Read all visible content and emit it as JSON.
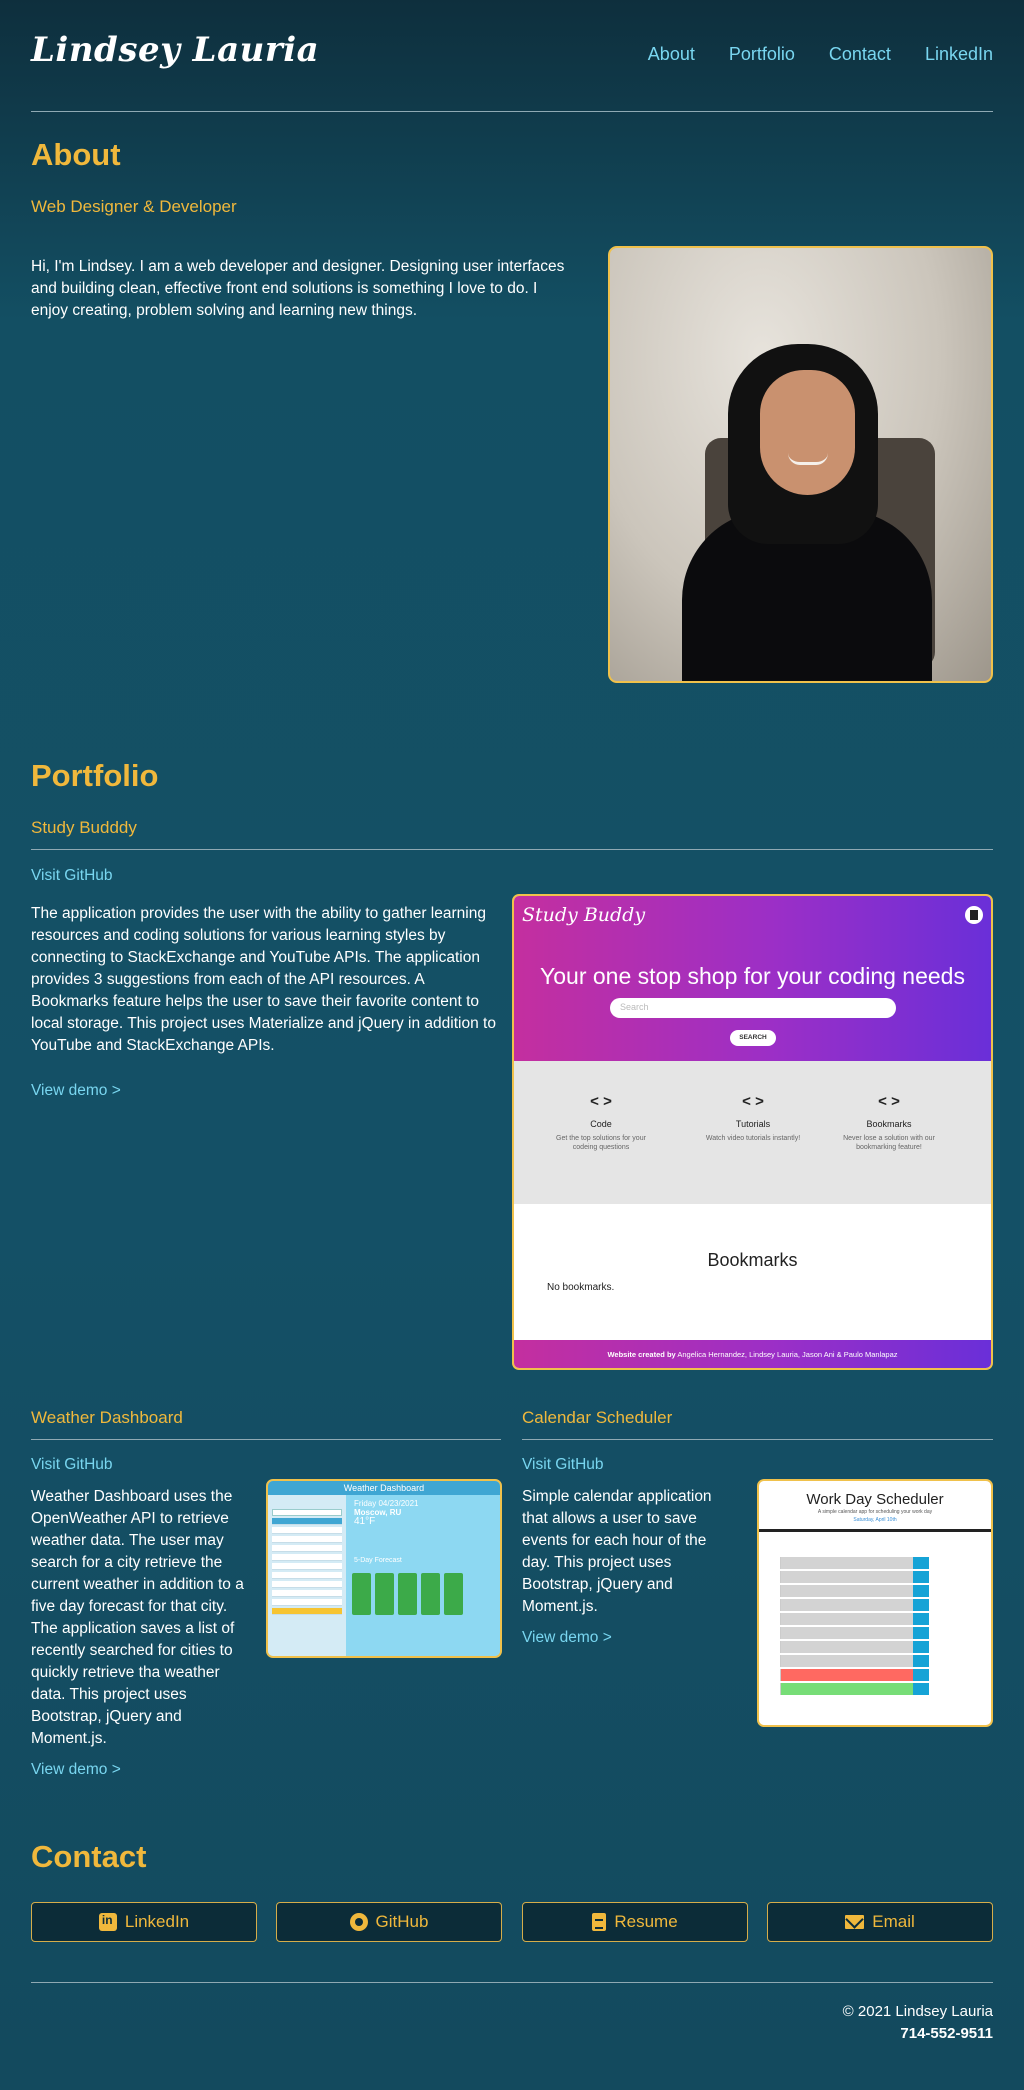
{
  "header": {
    "brand": "Lindsey Lauria",
    "nav": [
      "About",
      "Portfolio",
      "Contact",
      "LinkedIn"
    ]
  },
  "about": {
    "heading": "About",
    "subtitle": "Web Designer & Developer",
    "bio": "Hi, I'm Lindsey. I am a web developer and designer. Designing user interfaces and building clean, effective front end solutions is something I love to do. I enjoy creating, problem solving and learning new things."
  },
  "portfolio": {
    "heading": "Portfolio",
    "projects": [
      {
        "title": "Study Budddy",
        "github": "Visit GitHub",
        "description": "The application provides the user with the ability to gather learning resources and coding solutions for various learning styles by connecting to StackExchange and YouTube APIs. The application provides 3 suggestions from each of the API resources. A Bookmarks feature helps the user to save their favorite content to local storage. This project uses Materialize and jQuery in addition to YouTube and StackExchange APIs.",
        "demo": "View demo >",
        "screenshot": {
          "logo": "Study Buddy",
          "headline": "Your one stop shop for your coding needs",
          "search_placeholder": "Search",
          "search_button": "SEARCH",
          "features": [
            {
              "icon": "< >",
              "title": "Code",
              "desc": "Get the top solutions for your codeing questions"
            },
            {
              "icon": "< >",
              "title": "Tutorials",
              "desc": "Watch video tutorials instantly!"
            },
            {
              "icon": "< >",
              "title": "Bookmarks",
              "desc": "Never lose a solution with our bookmarking feature!"
            }
          ],
          "bookmarks_title": "Bookmarks",
          "bookmarks_empty": "No bookmarks.",
          "footer_lead": "Website created by",
          "footer_names": "Angelica Hernandez, Lindsey Lauria, Jason Ani & Paulo Manlapaz"
        }
      },
      {
        "title": "Weather Dashboard",
        "github": "Visit GitHub",
        "description": "Weather Dashboard uses the OpenWeather API to retrieve weather data. The user may search for a city retrieve the current weather in addition to a five day forecast for that city. The application saves a list of recently searched for cities to quickly retrieve tha weather data. This project uses Bootstrap, jQuery and Moment.js.",
        "demo": "View demo >",
        "screenshot": {
          "title": "Weather Dashboard",
          "date": "Friday 04/23/2021",
          "city": "Moscow, RU",
          "temp": "41°F",
          "forecast_label": "5-Day Forecast"
        }
      },
      {
        "title": "Calendar Scheduler",
        "github": "Visit GitHub",
        "description": "Simple calendar application that allows a user to save events for each hour of the day. This project uses Bootstrap, jQuery and Moment.js.",
        "demo": "View demo >",
        "screenshot": {
          "title": "Work Day Scheduler",
          "subtitle": "A simple calendar app for scheduling your work day",
          "date": "Saturday, April 10th"
        }
      }
    ]
  },
  "contact": {
    "heading": "Contact",
    "buttons": [
      "LinkedIn",
      "GitHub",
      "Resume",
      "Email"
    ]
  },
  "footer": {
    "copyright": "© 2021 Lindsey Lauria",
    "phone": "714-552-9511"
  },
  "colors": {
    "accent": "#f0b83c",
    "link": "#79d6f0",
    "background": "#134f63"
  }
}
